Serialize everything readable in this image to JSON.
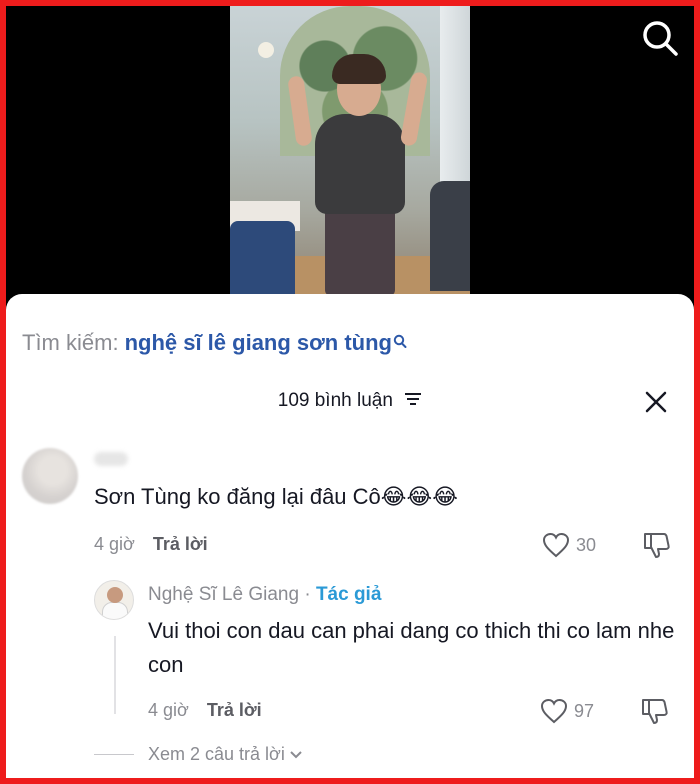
{
  "search": {
    "prefix": "Tìm kiếm:",
    "query": "nghệ sĩ lê giang sơn tùng"
  },
  "comments_header": {
    "count_label": "109 bình luận"
  },
  "comment": {
    "text": "Sơn Tùng ko đăng lại đâu Cô",
    "emoji": "😂😂😂",
    "time": "4 giờ",
    "reply_label": "Trả lời",
    "likes": "30"
  },
  "reply": {
    "username": "Nghệ Sĩ Lê Giang",
    "separator": "·",
    "author_badge": "Tác giả",
    "text": "Vui thoi con dau can phai dang co thich thi co lam nhe con",
    "time": "4 giờ",
    "reply_label": "Trả lời",
    "likes": "97"
  },
  "view_more_replies": "Xem 2 câu trả lời"
}
